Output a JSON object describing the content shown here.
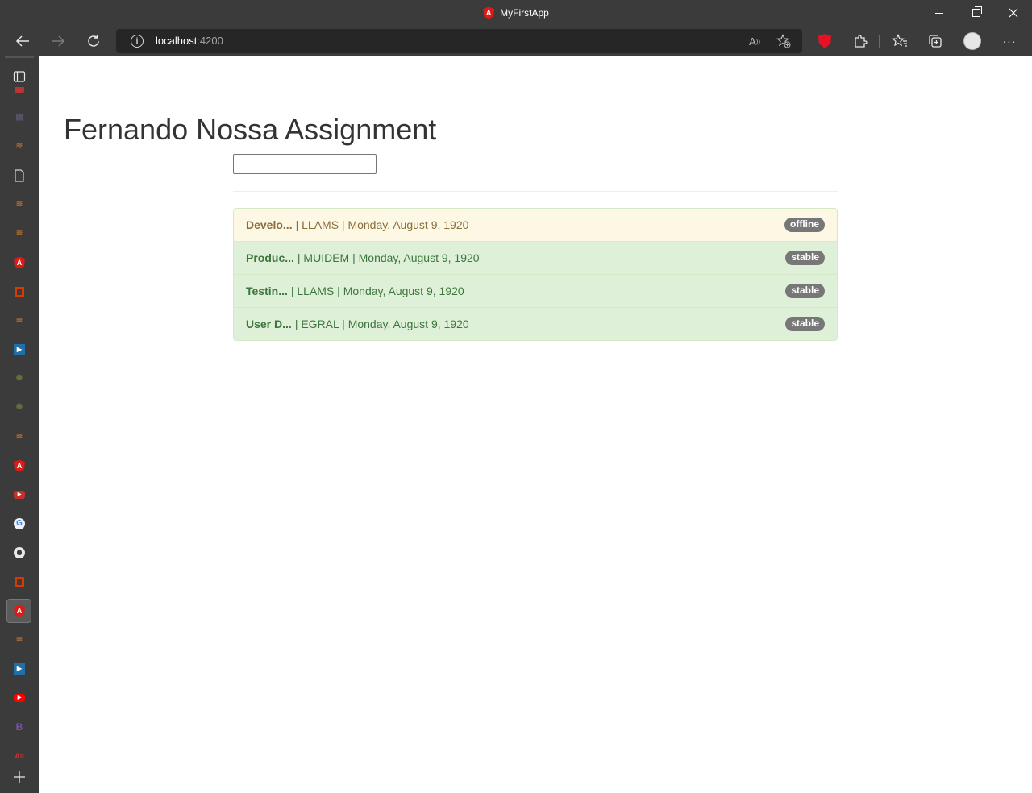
{
  "window": {
    "title": "MyFirstApp"
  },
  "toolbar": {
    "url_host": "localhost",
    "url_port": ":4200"
  },
  "page": {
    "title": "Fernando Nossa Assignment",
    "search": {
      "value": "",
      "placeholder": ""
    },
    "items": [
      {
        "name": "Develo...",
        "meta": "| LLAMS | Monday, August 9, 1920",
        "status": "offline",
        "variant": "warning"
      },
      {
        "name": "Produc...",
        "meta": "| MUIDEM | Monday, August 9, 1920",
        "status": "stable",
        "variant": "success"
      },
      {
        "name": "Testin...",
        "meta": "| LLAMS | Monday, August 9, 1920",
        "status": "stable",
        "variant": "success"
      },
      {
        "name": "User D...",
        "meta": "| EGRAL | Monday, August 9, 1920",
        "status": "stable",
        "variant": "success"
      }
    ]
  },
  "sidebar": {
    "icons": [
      "tab-actions-icon",
      "favicon-red-icon",
      "favicon-blue-icon",
      "stackoverflow-icon",
      "document-icon",
      "stackoverflow-icon",
      "stackoverflow-icon",
      "angular-icon",
      "office-icon",
      "stackoverflow-icon",
      "powerapps-icon",
      "gear-site-icon",
      "gear-site-icon",
      "stackoverflow-icon",
      "angular-icon",
      "youtube-icon",
      "google-icon",
      "github-icon",
      "office-icon",
      "angular-icon",
      "stackoverflow-icon",
      "powerapps-icon",
      "youtube-icon",
      "bootstrap-icon",
      "angular-translate-icon"
    ]
  },
  "colors": {
    "chrome_bg": "#3b3b3b",
    "warning_bg": "#fcf8e3",
    "warning_text": "#8a6d3b",
    "success_bg": "#dff0d8",
    "success_text": "#3c763d",
    "badge_bg": "#777777"
  }
}
